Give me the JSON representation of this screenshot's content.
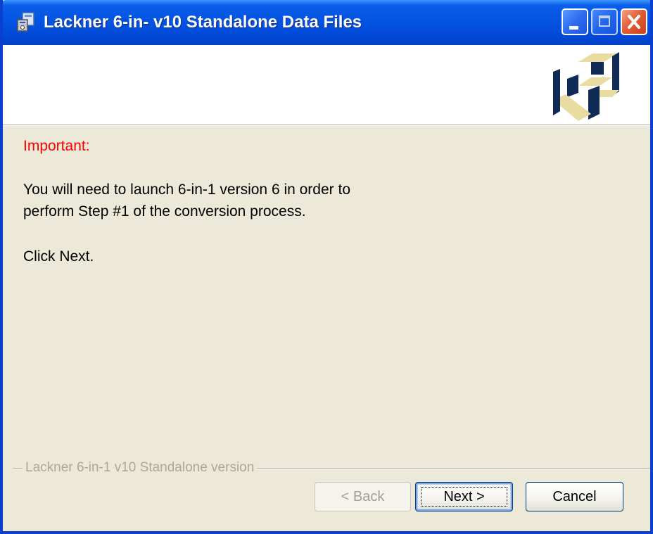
{
  "window": {
    "title": "Lackner 6-in- v10 Standalone Data Files"
  },
  "content": {
    "important_label": "Important:",
    "message_line1": "You will need to launch 6-in-1 version 6 in order to",
    "message_line2": "perform Step #1 of the conversion process.",
    "instruction": "Click Next."
  },
  "footer": {
    "group_label": "Lackner 6-in-1 v10 Standalone version",
    "back_label": "< Back",
    "next_label": "Next >",
    "cancel_label": "Cancel"
  },
  "icons": {
    "title_icon": "installer-icon",
    "logo": "lackner-cube-logo",
    "minimize": "minimize-icon",
    "maximize": "maximize-icon",
    "close": "close-icon"
  },
  "colors": {
    "titlebar": "#0454e3",
    "dialog_bg": "#ece9d8",
    "important_text": "#ff0000",
    "logo_navy": "#0f2a55",
    "logo_tan": "#e8dca0"
  },
  "state": {
    "back_enabled": false,
    "maximize_enabled": false,
    "default_button": "Next >"
  }
}
